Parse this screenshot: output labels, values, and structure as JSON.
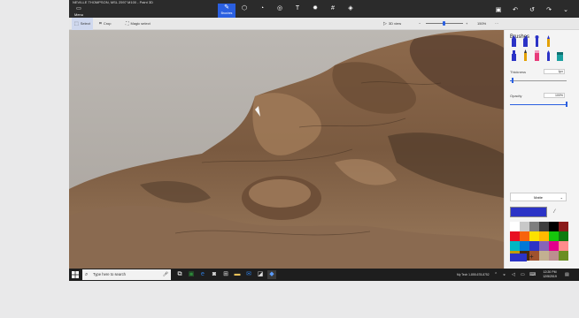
{
  "window": {
    "title": "NEVILLE THOMPSON, MSL 2597 M100 - Paint 3D",
    "menu_label": "Menu"
  },
  "ribbon": {
    "tools": [
      {
        "name": "brushes",
        "label": "Brushes",
        "icon": "brush-icon",
        "active": true
      },
      {
        "name": "2d-shapes",
        "label": "",
        "icon": "2d-shapes-icon"
      },
      {
        "name": "3d-shapes",
        "label": "",
        "icon": "3d-shapes-icon"
      },
      {
        "name": "stickers",
        "label": "",
        "icon": "stickers-icon"
      },
      {
        "name": "text",
        "label": "",
        "icon": "text-icon"
      },
      {
        "name": "effects",
        "label": "",
        "icon": "effects-icon"
      },
      {
        "name": "canvas",
        "label": "",
        "icon": "canvas-icon"
      },
      {
        "name": "3d-library",
        "label": "",
        "icon": "3d-library-icon"
      }
    ]
  },
  "toolbar": {
    "select_label": "Select",
    "crop_label": "Crop",
    "magic_select_label": "Magic select",
    "view_label": "3D view",
    "zoom_value": "150%",
    "zoom_level": 0.45
  },
  "panel": {
    "title": "Brushes",
    "thickness_label": "Thickness",
    "thickness_value": "1px",
    "thickness_level": 0.04,
    "opacity_label": "Opacity",
    "opacity_value": "100%",
    "opacity_level": 1.0,
    "finish_label": "Matte",
    "current_color": "#2b33c6",
    "palette": [
      "#ffffff",
      "#c8c8c8",
      "#7f7f7f",
      "#3d3d3d",
      "#000000",
      "#8b1c1c",
      "#e81123",
      "#f7630c",
      "#fce100",
      "#ffb900",
      "#16c60c",
      "#0f7b0f",
      "#00b7c3",
      "#0078d7",
      "#2b33c6",
      "#8764b8",
      "#e3008c",
      "#ff8c8c",
      "#c19c00",
      "#4a2a0a",
      "#a0522d",
      "#c3b091",
      "#bc8f8f",
      "#6b8e23"
    ]
  },
  "taskbar": {
    "search_placeholder": "Type here to search",
    "tray_text": "My Tech 1-855-678-8752",
    "time": "12:20 PM",
    "date": "12/5/2019"
  }
}
